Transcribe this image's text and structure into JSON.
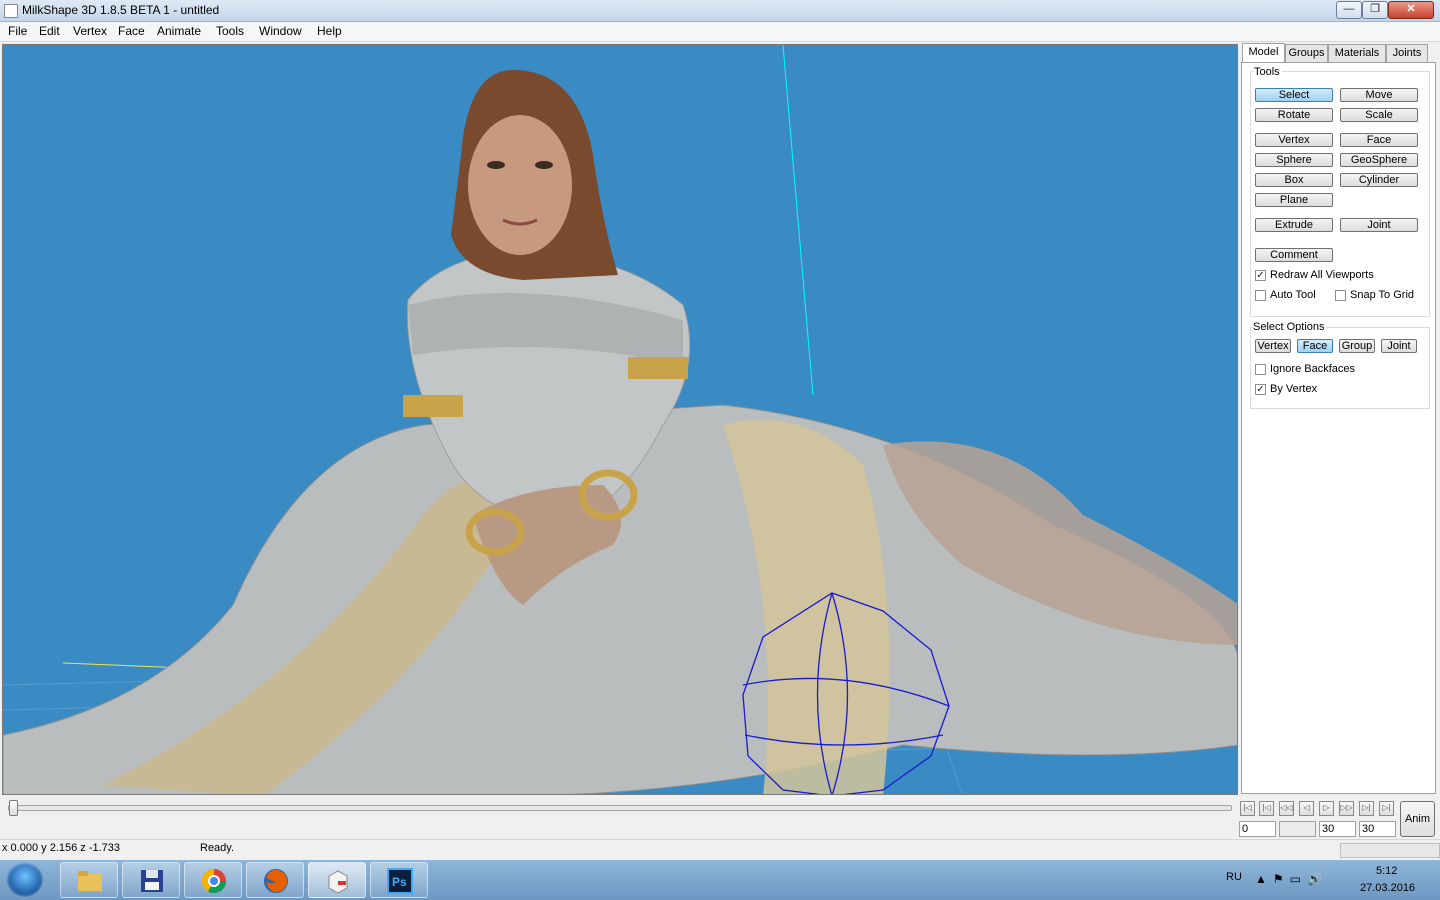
{
  "window": {
    "title": "MilkShape 3D 1.8.5 BETA 1 - untitled",
    "min": "—",
    "max": "❐",
    "close": "✕"
  },
  "menu": [
    "File",
    "Edit",
    "Vertex",
    "Face",
    "Animate",
    "Tools",
    "Window",
    "Help"
  ],
  "tabs": [
    "Model",
    "Groups",
    "Materials",
    "Joints"
  ],
  "tools": {
    "label": "Tools",
    "buttons": [
      "Select",
      "Move",
      "Rotate",
      "Scale",
      "Vertex",
      "Face",
      "Sphere",
      "GeoSphere",
      "Box",
      "Cylinder",
      "Plane",
      "Extrude",
      "Joint",
      "Comment"
    ],
    "checks": [
      {
        "label": "Redraw All Viewports",
        "checked": true
      },
      {
        "label": "Auto Tool",
        "checked": false
      },
      {
        "label": "Snap To Grid",
        "checked": false
      }
    ]
  },
  "select_options": {
    "label": "Select Options",
    "buttons": [
      "Vertex",
      "Face",
      "Group",
      "Joint"
    ],
    "checks": [
      {
        "label": "Ignore Backfaces",
        "checked": false
      },
      {
        "label": "By Vertex",
        "checked": true
      }
    ]
  },
  "timeline": {
    "nav": [
      "|◁",
      "|◁",
      "◁◁",
      "◁",
      "▷",
      "▷▷",
      "▷|",
      "▷|"
    ],
    "fields": [
      "0",
      "",
      "30",
      "30"
    ],
    "anim": "Anim"
  },
  "status": {
    "coords": "x 0.000 y 2.156 z -1.733",
    "message": "Ready."
  },
  "taskbar": {
    "lang": "RU",
    "time": "5:12",
    "date": "27.03.2016"
  },
  "colors": {
    "viewport_bg": "#3a8ac4",
    "selected_button": "#9fd0f4",
    "axis_cyan": "#00ffff",
    "axis_yellow": "#e8e85a",
    "sphere_wire": "#1a1ad0"
  }
}
